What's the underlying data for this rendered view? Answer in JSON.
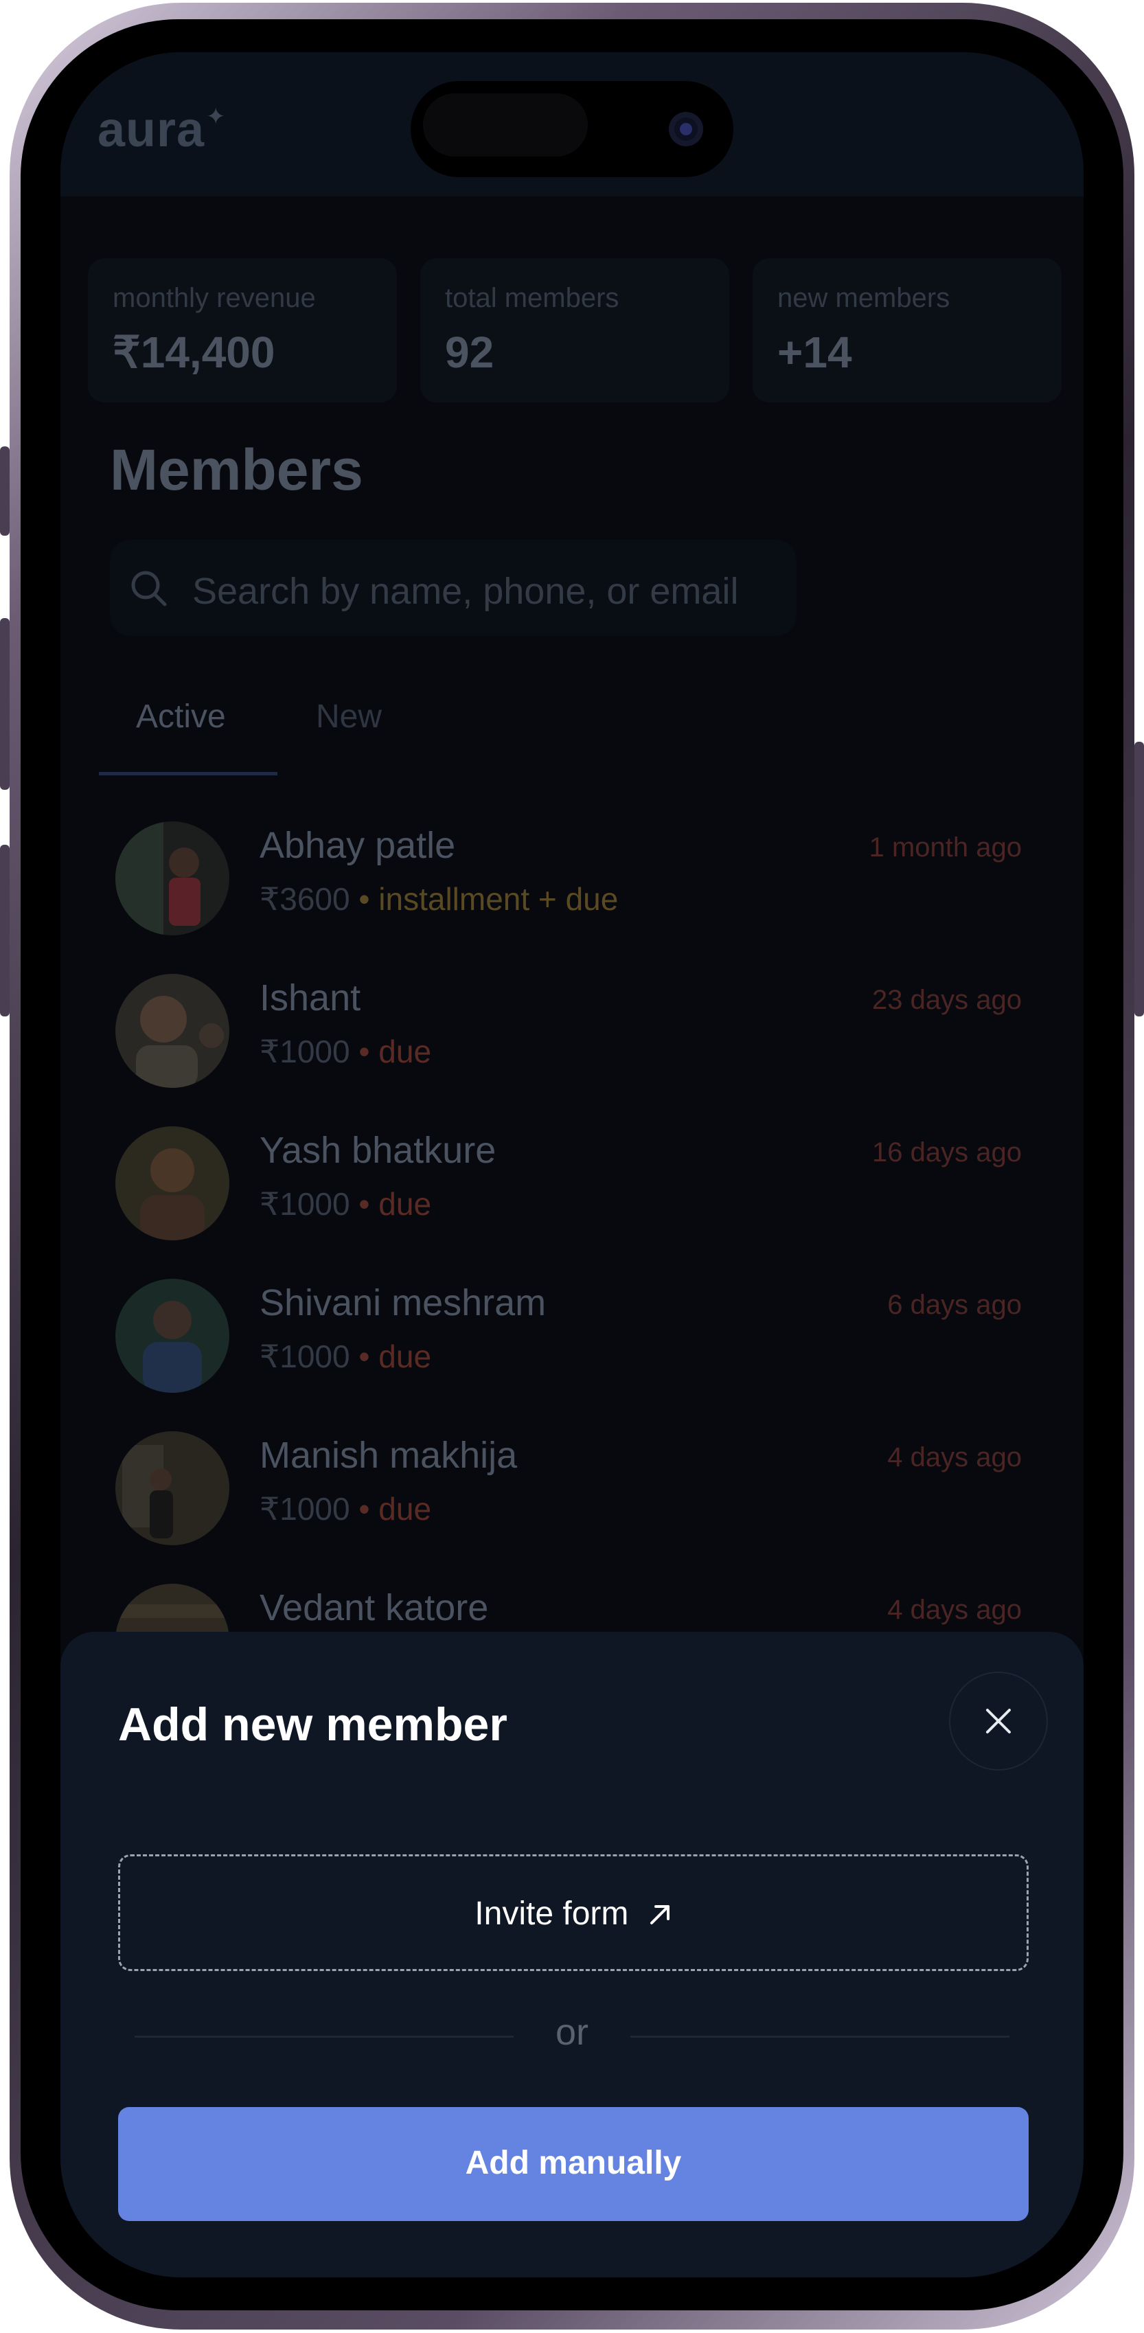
{
  "app": {
    "logo": "aura",
    "logo_mark": "✦"
  },
  "stats": [
    {
      "label": "monthly revenue",
      "value": "₹14,400"
    },
    {
      "label": "total members",
      "value": "92"
    },
    {
      "label": "new members",
      "value": "+14"
    }
  ],
  "members_page": {
    "title": "Members",
    "search_placeholder": "Search by name, phone, or email",
    "tabs": [
      {
        "label": "Active",
        "selected": true
      },
      {
        "label": "New",
        "selected": false
      }
    ],
    "list": [
      {
        "name": "Abhay patle",
        "amount": "₹3600",
        "status": "• installment + due",
        "time": "1 month ago"
      },
      {
        "name": "Ishant",
        "amount": "₹1000",
        "status": "• due",
        "time": "23 days ago"
      },
      {
        "name": "Yash bhatkure",
        "amount": "₹1000",
        "status": "• due",
        "time": "16 days ago"
      },
      {
        "name": "Shivani meshram",
        "amount": "₹1000",
        "status": "• due",
        "time": "6 days ago"
      },
      {
        "name": "Manish makhija",
        "amount": "₹1000",
        "status": "• due",
        "time": "4 days ago"
      },
      {
        "name": "Vedant katore",
        "amount": "",
        "status": "",
        "time": "4 days ago"
      }
    ]
  },
  "sheet": {
    "title": "Add new member",
    "invite_label": "Invite form",
    "divider_text": "or",
    "add_manually_label": "Add manually"
  },
  "colors": {
    "primary_button": "#6583e0",
    "sheet_background": "#0f1725",
    "installment": "#5a4a23",
    "due": "#5a2a24"
  }
}
